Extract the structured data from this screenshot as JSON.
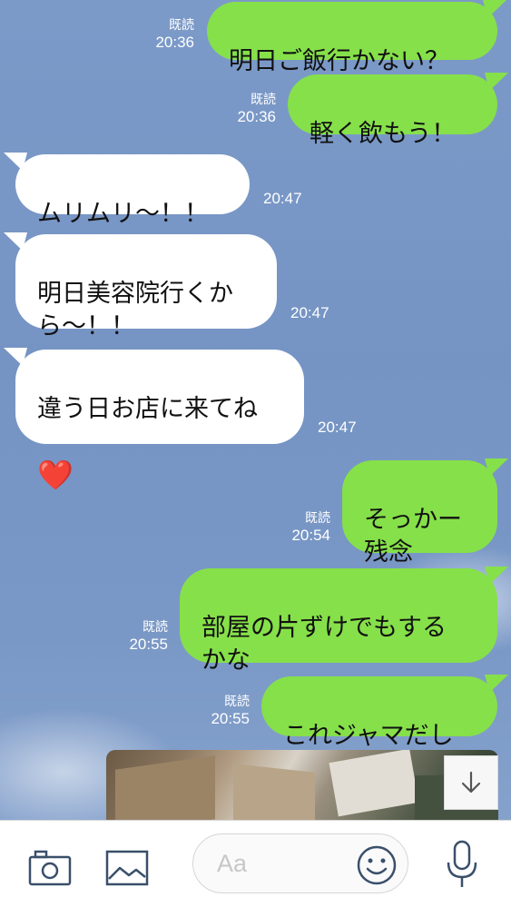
{
  "messages": [
    {
      "dir": "out",
      "text": "明日ご飯行かない？",
      "read": "既読",
      "time": "20:36"
    },
    {
      "dir": "out",
      "text": "軽く飲もう！",
      "read": "既読",
      "time": "20:36"
    },
    {
      "dir": "in",
      "text": "ムリムリ〜！！",
      "time": "20:47"
    },
    {
      "dir": "in",
      "text": "明日美容院行くか\nら〜！！",
      "time": "20:47"
    },
    {
      "dir": "in",
      "text": "違う日お店に来てね",
      "emoji": "❤️",
      "time": "20:47"
    },
    {
      "dir": "out",
      "text": "そっかー\n残念",
      "read": "既読",
      "time": "20:54"
    },
    {
      "dir": "out",
      "text": "部屋の片ずけでもする\nかな",
      "read": "既読",
      "time": "20:55"
    },
    {
      "dir": "out",
      "text": "これジャマだし",
      "read": "既読",
      "time": "20:55"
    }
  ],
  "input": {
    "placeholder": "Aa"
  },
  "icons": {
    "camera": "camera-icon",
    "image": "image-icon",
    "emoji": "smiley-icon",
    "mic": "microphone-icon",
    "scroll": "arrow-down-icon"
  },
  "colors": {
    "outgoing": "#86e04a",
    "incoming": "#ffffff",
    "background": "#7594c4"
  }
}
